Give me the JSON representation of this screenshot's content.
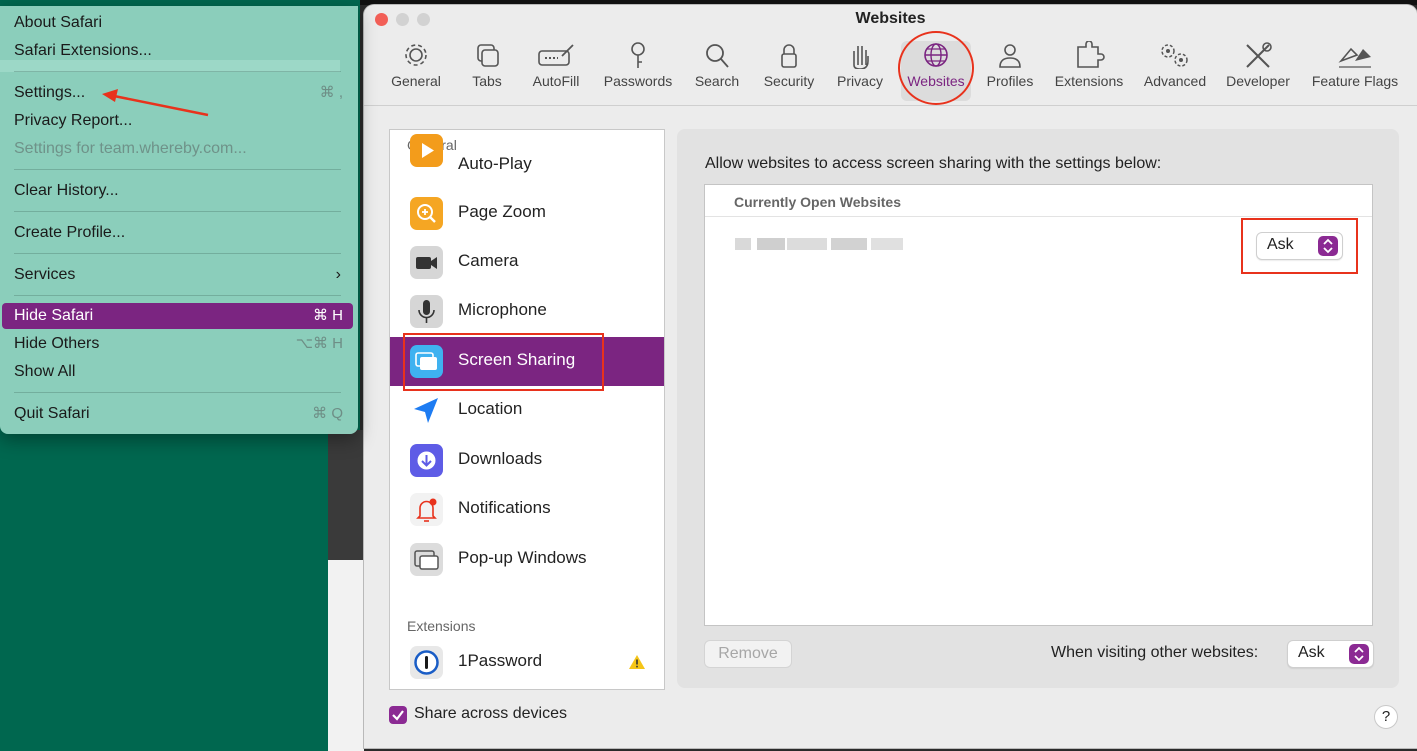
{
  "menu": {
    "items": [
      {
        "label": "About Safari",
        "shortcut": ""
      },
      {
        "label": "Safari Extensions...",
        "shortcut": ""
      },
      {
        "label": "Settings...",
        "shortcut": "⌘ ,"
      },
      {
        "label": "Privacy Report...",
        "shortcut": ""
      },
      {
        "label": "Settings for team.whereby.com...",
        "shortcut": ""
      },
      {
        "label": "Clear History...",
        "shortcut": ""
      },
      {
        "label": "Create Profile...",
        "shortcut": ""
      },
      {
        "label": "Services",
        "shortcut": ""
      },
      {
        "label": "Hide Safari",
        "shortcut": "⌘ H"
      },
      {
        "label": "Hide Others",
        "shortcut": "⌥⌘ H"
      },
      {
        "label": "Show All",
        "shortcut": ""
      },
      {
        "label": "Quit Safari",
        "shortcut": "⌘ Q"
      }
    ],
    "services_chevron": "›"
  },
  "window": {
    "title": "Websites",
    "toolbar": [
      {
        "label": "General",
        "icon": "gear-icon"
      },
      {
        "label": "Tabs",
        "icon": "tabs-icon"
      },
      {
        "label": "AutoFill",
        "icon": "autofill-icon"
      },
      {
        "label": "Passwords",
        "icon": "key-icon"
      },
      {
        "label": "Search",
        "icon": "search-icon"
      },
      {
        "label": "Security",
        "icon": "lock-icon"
      },
      {
        "label": "Privacy",
        "icon": "hand-icon"
      },
      {
        "label": "Websites",
        "icon": "globe-icon"
      },
      {
        "label": "Profiles",
        "icon": "person-icon"
      },
      {
        "label": "Extensions",
        "icon": "puzzle-icon"
      },
      {
        "label": "Advanced",
        "icon": "gears-icon"
      },
      {
        "label": "Developer",
        "icon": "tools-icon"
      },
      {
        "label": "Feature Flags",
        "icon": "flags-icon"
      }
    ]
  },
  "sidebar": {
    "general_header": "General",
    "items": [
      {
        "label": "Auto-Play",
        "icon": "play-icon"
      },
      {
        "label": "Page Zoom",
        "icon": "zoom-icon"
      },
      {
        "label": "Camera",
        "icon": "camera-icon"
      },
      {
        "label": "Microphone",
        "icon": "microphone-icon"
      },
      {
        "label": "Screen Sharing",
        "icon": "screen-sharing-icon"
      },
      {
        "label": "Location",
        "icon": "location-arrow-icon"
      },
      {
        "label": "Downloads",
        "icon": "download-icon"
      },
      {
        "label": "Notifications",
        "icon": "bell-icon"
      },
      {
        "label": "Pop-up Windows",
        "icon": "popup-window-icon"
      }
    ],
    "extensions_header": "Extensions",
    "extensions": [
      {
        "label": "1Password",
        "icon": "onepassword-icon"
      }
    ]
  },
  "main": {
    "description": "Allow websites to access screen sharing with the settings below:",
    "list_header": "Currently Open Websites",
    "site_setting": "Ask",
    "remove_label": "Remove",
    "other_label": "When visiting other websites:",
    "other_setting": "Ask"
  },
  "footer": {
    "share_label": "Share across devices",
    "share_checked": true,
    "help_label": "?"
  },
  "colors": {
    "accent": "#7b2581",
    "annotation": "#e8321c",
    "menu_bg": "#96d6c4",
    "desktop_green": "#00674f"
  }
}
